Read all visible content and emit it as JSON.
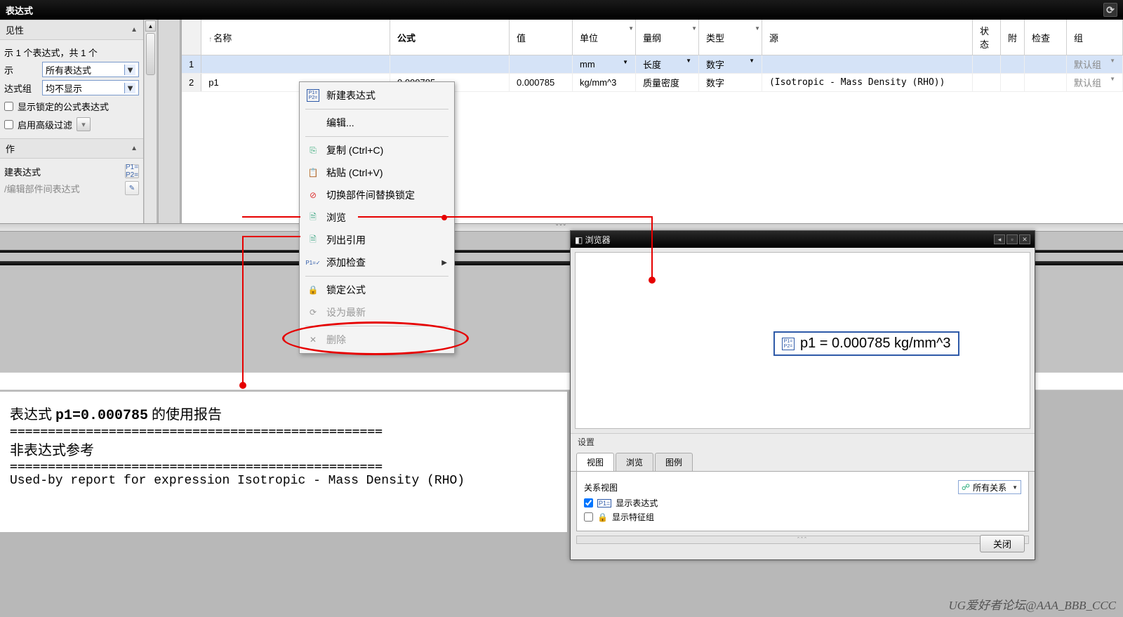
{
  "title": "表达式",
  "leftPane": {
    "group1": "见性",
    "countLabel": "示 1 个表达式，共 1 个",
    "r1_label": "示",
    "r1_value": "所有表达式",
    "r2_label": "达式组",
    "r2_value": "均不显示",
    "chk_lock": "显示锁定的公式表达式",
    "chk_adv": "启用高级过滤",
    "group2": "作",
    "newExpr": "建表达式",
    "editPart": "/编辑部件间表达式"
  },
  "grid": {
    "cols": {
      "name": "名称",
      "formula": "公式",
      "value": "值",
      "unit": "单位",
      "dim": "量纲",
      "type": "类型",
      "source": "源",
      "status": "状态",
      "att": "附",
      "check": "检查",
      "group": "组"
    },
    "rows": [
      {
        "n": "1",
        "name": "",
        "formula": "",
        "value": "",
        "unit": "mm",
        "dim": "长度",
        "type": "数字",
        "source": "",
        "group": "默认组"
      },
      {
        "n": "2",
        "name": "p1",
        "formula": "0.000785",
        "value": "0.000785",
        "unit": "kg/mm^3",
        "dim": "质量密度",
        "type": "数字",
        "source": "(Isotropic - Mass Density (RHO))",
        "group": "默认组"
      }
    ]
  },
  "contextMenu": {
    "newExpr": "新建表达式",
    "edit": "编辑...",
    "copy": "复制 (Ctrl+C)",
    "paste": "粘贴 (Ctrl+V)",
    "toggleLock": "切换部件间替换锁定",
    "browse": "浏览",
    "listRefs": "列出引用",
    "addCheck": "添加检查",
    "lockFormula": "锁定公式",
    "setNewest": "设为最新",
    "delete": "删除"
  },
  "report": {
    "line1_a": "表达式 ",
    "line1_b": "p1=0.000785",
    "line1_c": " 的使用报告",
    "sep": "=================================================",
    "line2": "非表达式参考",
    "line3": "Used-by report for expression Isotropic - Mass Density (RHO)"
  },
  "browser": {
    "title": "浏览器",
    "node": "p1 = 0.000785 kg/mm^3",
    "settings": "设置",
    "tabs": {
      "view": "视图",
      "browse": "浏览",
      "legend": "图例"
    },
    "relView": "关系视图",
    "comboAll": "所有关系",
    "chk1": "显示表达式",
    "chk2": "显示特征组",
    "close": "关闭"
  },
  "watermark": "UG爱好者论坛@AAA_BBB_CCC"
}
